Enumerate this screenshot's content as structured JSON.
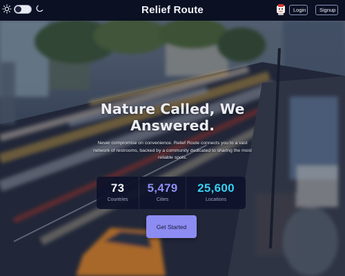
{
  "header": {
    "brand": "Relief Route",
    "login_label": "Login",
    "signup_label": "Signup",
    "theme_toggle": {
      "left_icon": "sun-icon",
      "right_icon": "moon-icon",
      "state": "light"
    }
  },
  "hero": {
    "title_line1": "Nature Called, We",
    "title_line2": "Answered.",
    "subtitle": "Never compromise on convenience. Relief Route connects you to a vast network of restrooms, backed by a community dedicated to sharing the most reliable spots.",
    "stats": [
      {
        "value": "73",
        "label": "Countries",
        "color": "#f3f4f8"
      },
      {
        "value": "5,479",
        "label": "Cities",
        "color": "#8f8ff5"
      },
      {
        "value": "25,600",
        "label": "Locations",
        "color": "#37d0f0"
      }
    ],
    "cta_label": "Get Started",
    "background": "blurred-city-street-traffic-photo"
  },
  "colors": {
    "header_bg": "#0b1022",
    "cta_bg": "#8c8cf2",
    "stats_bg": "#0e122a"
  }
}
